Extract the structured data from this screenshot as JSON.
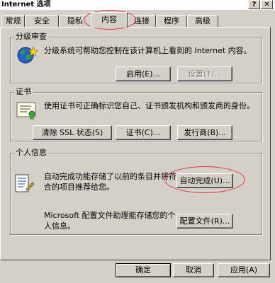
{
  "window": {
    "title": "Internet 选项",
    "help_glyph": "?",
    "close_glyph": "✕"
  },
  "tabs": [
    {
      "label": "常规"
    },
    {
      "label": "安全"
    },
    {
      "label": "隐私"
    },
    {
      "label": "内容"
    },
    {
      "label": "连接"
    },
    {
      "label": "程序"
    },
    {
      "label": "高级"
    }
  ],
  "rating": {
    "legend": "分级审查",
    "description": "分级系统可帮助您控制在该计算机上看到的 Internet 内容。",
    "enable_label": "启用(E)...",
    "settings_label": "设置(T)..."
  },
  "certificates": {
    "legend": "证书",
    "description": "使用证书可正确标识您自己、证书颁发机构和颁发商的身份。",
    "clear_ssl_label": "清除 SSL 状态(S)",
    "certificates_label": "证书(C)...",
    "publishers_label": "发行商(B)..."
  },
  "personal": {
    "legend": "个人信息",
    "autocomplete_text": "自动完成功能存储了以前的条目并将符合的项目推荐给您。",
    "autocomplete_label": "自动完成(U)...",
    "profile_text": "Microsoft 配置文件助理能存储您的个人信息。",
    "profile_label": "配置文件(R)..."
  },
  "footer": {
    "ok_label": "确定",
    "cancel_label": "取消",
    "apply_label": "应用(A)"
  },
  "colors": {
    "face": "#d4d0c8",
    "annotation": "#e0303a"
  }
}
